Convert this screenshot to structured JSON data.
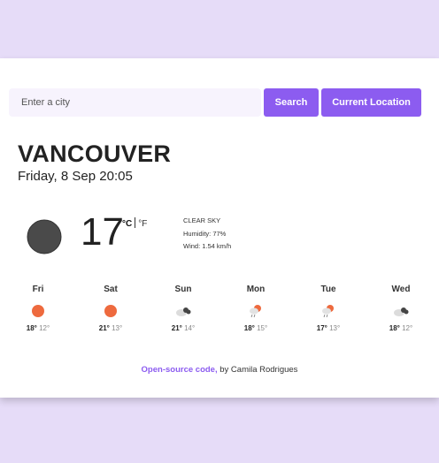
{
  "search": {
    "placeholder": "Enter a city",
    "search_label": "Search",
    "location_label": "Current Location"
  },
  "current": {
    "city": "VANCOUVER",
    "datetime": "Friday, 8 Sep 20:05",
    "temperature": "17",
    "unit_celsius": "°C",
    "unit_fahrenheit": "°F",
    "condition": "CLEAR SKY",
    "humidity": "Humidity: 77%",
    "wind": "Wind: 1.54 km/h",
    "icon": "moon-icon"
  },
  "forecast": [
    {
      "day": "Fri",
      "max": "18°",
      "min": "12°",
      "icon": "sun-icon"
    },
    {
      "day": "Sat",
      "max": "21°",
      "min": "13°",
      "icon": "sun-icon"
    },
    {
      "day": "Sun",
      "max": "21°",
      "min": "14°",
      "icon": "cloudy-icon"
    },
    {
      "day": "Mon",
      "max": "18°",
      "min": "15°",
      "icon": "rain-sun-icon"
    },
    {
      "day": "Tue",
      "max": "17°",
      "min": "13°",
      "icon": "rain-sun-icon"
    },
    {
      "day": "Wed",
      "max": "18°",
      "min": "12°",
      "icon": "cloudy-icon"
    }
  ],
  "footer": {
    "link_text": "Open-source code,",
    "credit": " by Camila Rodrigues"
  },
  "colors": {
    "accent": "#8c5cf0",
    "background": "#e6dcf8",
    "sun": "#ee6a3e"
  }
}
